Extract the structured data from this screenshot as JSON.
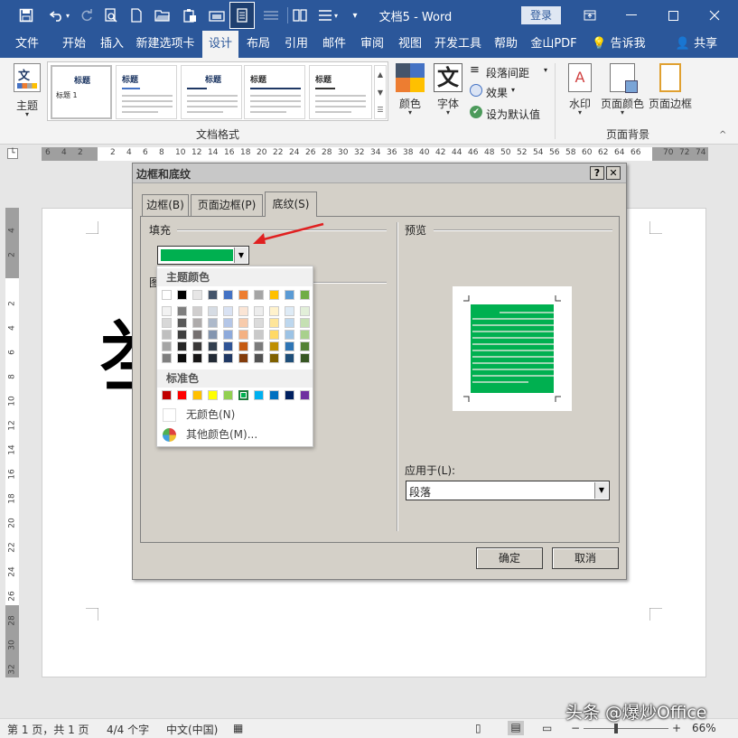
{
  "titlebar": {
    "doc_title": "文档5 - Word",
    "login": "登录",
    "color": "#2b579a",
    "quick_access": [
      "save-icon",
      "undo-icon",
      "redo-icon",
      "print-preview-icon",
      "new-doc-icon",
      "open-icon",
      "paste-icon",
      "screenshot-icon",
      "page-view-icon",
      "format-icon",
      "columns-icon",
      "spacing-icon",
      "customize-icon"
    ],
    "window_buttons": [
      "ribbon-display-icon",
      "minimize-icon",
      "maximize-icon",
      "close-icon"
    ]
  },
  "ribbon_tabs": [
    {
      "label": "文件"
    },
    {
      "label": "开始"
    },
    {
      "label": "插入"
    },
    {
      "label": "新建选项卡"
    },
    {
      "label": "设计",
      "active": true
    },
    {
      "label": "布局"
    },
    {
      "label": "引用"
    },
    {
      "label": "邮件"
    },
    {
      "label": "审阅"
    },
    {
      "label": "视图"
    },
    {
      "label": "开发工具"
    },
    {
      "label": "帮助"
    },
    {
      "label": "金山PDF"
    },
    {
      "label": "告诉我"
    },
    {
      "label": "共享"
    }
  ],
  "ribbon": {
    "theme_label": "主题",
    "gallery": {
      "group_label": "文档格式",
      "first_title": "标题",
      "first_sub": "标题 1",
      "item_title": "标题"
    },
    "colors_label": "颜色",
    "fonts_label": "字体",
    "fonts_glyph": "文",
    "para_spacing": "段落间距",
    "effects": "效果",
    "set_default": "设为默认值",
    "watermark": "水印",
    "page_color": "页面颜色",
    "page_border": "页面边框",
    "page_bg_group": "页面背景"
  },
  "ruler": {
    "h_ticks": [
      "6",
      "4",
      "2",
      "",
      "2",
      "4",
      "6",
      "8",
      "10",
      "12",
      "14",
      "16",
      "18",
      "20",
      "22",
      "24",
      "26",
      "28",
      "30",
      "32",
      "34",
      "36",
      "38",
      "40",
      "42",
      "44",
      "46",
      "48",
      "50",
      "52",
      "54",
      "56",
      "58",
      "60",
      "62",
      "64",
      "66",
      "",
      "70",
      "72",
      "74"
    ],
    "v_ticks": [
      "4",
      "2",
      "",
      "2",
      "4",
      "6",
      "8",
      "10",
      "12",
      "14",
      "16",
      "18",
      "20",
      "22",
      "24",
      "26",
      "28",
      "30",
      "32"
    ]
  },
  "document": {
    "big_char": "举"
  },
  "dialog": {
    "title": "边框和底纹",
    "help": "?",
    "close": "✕",
    "tabs": [
      {
        "label": "边框(B)"
      },
      {
        "label": "页面边框(P)"
      },
      {
        "label": "底纹(S)",
        "active": true
      }
    ],
    "fill_label": "填充",
    "pattern_label": "图",
    "fill_color": "#00b050",
    "preview_label": "预览",
    "apply_label": "应用于(L):",
    "apply_value": "段落",
    "ok": "确定",
    "cancel": "取消"
  },
  "palette": {
    "theme_header": "主题颜色",
    "std_header": "标准色",
    "no_color": "无颜色(N)",
    "more_colors": "其他颜色(M)...",
    "theme_top": [
      "#ffffff",
      "#000000",
      "#e7e6e6",
      "#44546a",
      "#4472c4",
      "#ed7d31",
      "#a5a5a5",
      "#ffc000",
      "#5b9bd5",
      "#70ad47"
    ],
    "theme_shades": [
      [
        "#f2f2f2",
        "#7f7f7f",
        "#d0cece",
        "#d6dce4",
        "#d9e2f3",
        "#fbe5d5",
        "#ededed",
        "#fff2cc",
        "#deebf6",
        "#e2efd9"
      ],
      [
        "#d8d8d8",
        "#595959",
        "#aeabab",
        "#adb9ca",
        "#b4c6e7",
        "#f7cbac",
        "#dbdbdb",
        "#fee599",
        "#bdd7ee",
        "#c5e0b3"
      ],
      [
        "#bfbfbf",
        "#3f3f3f",
        "#757070",
        "#8496b0",
        "#8eaadb",
        "#f4b183",
        "#c9c9c9",
        "#ffd965",
        "#9cc3e5",
        "#a8d08d"
      ],
      [
        "#a5a5a5",
        "#262626",
        "#3a3838",
        "#323f4f",
        "#2f5496",
        "#c55a11",
        "#7b7b7b",
        "#bf8f00",
        "#2e75b5",
        "#538135"
      ],
      [
        "#7f7f7f",
        "#0c0c0c",
        "#171616",
        "#222a35",
        "#1f3864",
        "#833c0b",
        "#525252",
        "#7f6000",
        "#1e4e79",
        "#375623"
      ]
    ],
    "standard": [
      "#c00000",
      "#ff0000",
      "#ffc000",
      "#ffff00",
      "#92d050",
      "#00b050",
      "#00b0f0",
      "#0070c0",
      "#002060",
      "#7030a0"
    ],
    "selected_standard_index": 5
  },
  "statusbar": {
    "page": "第 1 页，共 1 页",
    "words": "4/4 个字",
    "lang": "中文(中国)",
    "zoom": "66%",
    "zoom_minus": "−",
    "zoom_plus": "+"
  },
  "watermark_text": "头条 @爆炒Office"
}
